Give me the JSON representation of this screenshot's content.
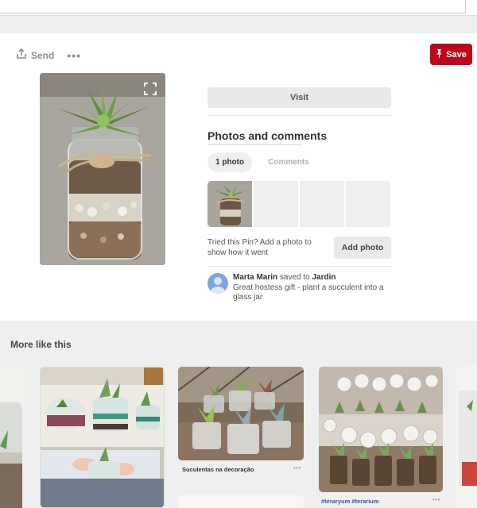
{
  "toolbar": {
    "send_label": "Send",
    "more_label": "•••",
    "save_label": "Save"
  },
  "pin": {
    "visit_label": "Visit"
  },
  "photos": {
    "section_title": "Photos and comments",
    "tabs": [
      {
        "label": "1 photo",
        "active": true
      },
      {
        "label": "Comments",
        "active": false
      }
    ],
    "tried_text": "Tried this Pin? Add a photo to show how it went",
    "add_photo_label": "Add photo"
  },
  "comment": {
    "author": "Marta Marin",
    "saved_to": " saved to ",
    "board": "Jardin",
    "text": "Great hostess gift - plant a succulent into a glass jar"
  },
  "more": {
    "title": "More like this",
    "tiles": [
      {
        "caption": "Suculentas na decoração"
      },
      {
        "caption": "#teraryum #terarium"
      }
    ]
  },
  "colors": {
    "save_red": "#bd081c",
    "background": "#efefef"
  }
}
